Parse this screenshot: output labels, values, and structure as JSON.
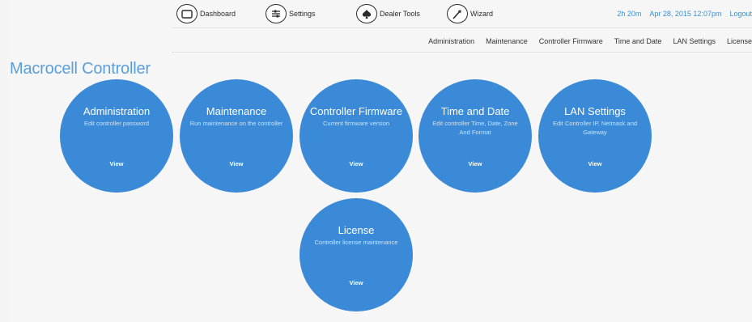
{
  "top_nav": {
    "items": [
      {
        "label": "Dashboard",
        "icon": "dashboard-icon"
      },
      {
        "label": "Settings",
        "icon": "settings-icon"
      },
      {
        "label": "Dealer Tools",
        "icon": "dealer-tools-icon"
      },
      {
        "label": "Wizard",
        "icon": "wizard-icon"
      }
    ],
    "timer": "2h 20m",
    "datetime": "Apr 28, 2015 12:07pm",
    "logout_label": "Logout"
  },
  "sub_nav": {
    "items": [
      "Administration",
      "Maintenance",
      "Controller Firmware",
      "Time and Date",
      "LAN Settings",
      "License"
    ]
  },
  "page_title": "Macrocell Controller",
  "tiles": [
    {
      "title": "Administration",
      "desc": "Edit controller password",
      "view": "View"
    },
    {
      "title": "Maintenance",
      "desc": "Run maintenance on the controller",
      "view": "View"
    },
    {
      "title": "Controller Firmware",
      "desc": "Current firmware version",
      "view": "View"
    },
    {
      "title": "Time and Date",
      "desc": "Edit controller Time, Date, Zone And Format",
      "view": "View"
    },
    {
      "title": "LAN Settings",
      "desc": "Edit Controller IP, Netmask and Gateway",
      "view": "View"
    },
    {
      "title": "License",
      "desc": "Controller license maintenance",
      "view": "View"
    }
  ],
  "colors": {
    "accent": "#3a8ad7",
    "title": "#5a9fdc",
    "status_text": "#3a8fd8"
  }
}
